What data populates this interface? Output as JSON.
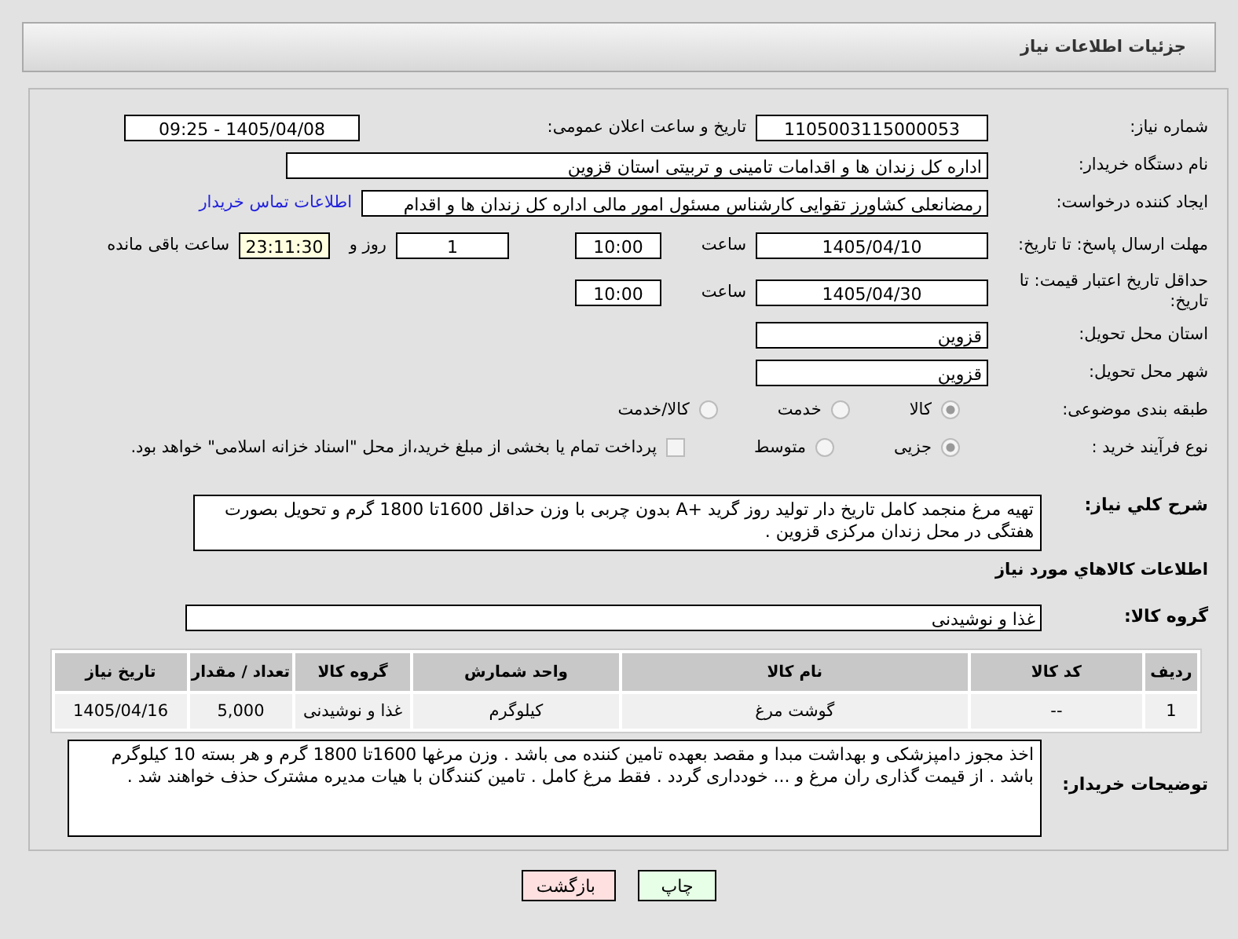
{
  "header": {
    "title": "جزئیات اطلاعات نیاز"
  },
  "need_number": {
    "label": "شماره نیاز:",
    "value": "1105003115000053"
  },
  "announce": {
    "label": "تاریخ و ساعت اعلان عمومی:",
    "value": "1405/04/08 - 09:25"
  },
  "buyer_org": {
    "label": "نام دستگاه خریدار:",
    "value": "اداره کل زندان ها و اقدامات تامینی و تربیتی استان قزوین"
  },
  "requester": {
    "label": "ایجاد کننده درخواست:",
    "value": "رمضانعلی کشاورز تقوایی کارشناس مسئول امور مالی  اداره کل زندان ها و اقدام",
    "link": "اطلاعات تماس خریدار"
  },
  "response_deadline": {
    "label": "مهلت ارسال پاسخ: تا تاریخ:",
    "date": "1405/04/10",
    "time_label": "ساعت",
    "time": "10:00",
    "days": "1",
    "days_label": "روز و",
    "remaining": "23:11:30",
    "remaining_label": "ساعت باقی مانده"
  },
  "price_validity": {
    "label": "حداقل تاریخ اعتبار قیمت: تا تاریخ:",
    "date": "1405/04/30",
    "time_label": "ساعت",
    "time": "10:00"
  },
  "province": {
    "label": "استان محل تحویل:",
    "value": "قزوین"
  },
  "city": {
    "label": "شهر محل تحویل:",
    "value": "قزوین"
  },
  "category": {
    "label": "طبقه بندی موضوعی:",
    "options": [
      {
        "label": "کالا",
        "selected": true
      },
      {
        "label": "خدمت",
        "selected": false
      },
      {
        "label": "کالا/خدمت",
        "selected": false
      }
    ]
  },
  "process": {
    "label": "نوع فرآیند خرید :",
    "options": [
      {
        "label": "جزیی",
        "selected": true
      },
      {
        "label": "متوسط",
        "selected": false
      }
    ],
    "payment": {
      "checked": false,
      "text": "پرداخت تمام یا بخشی از مبلغ خرید،از محل \"اسناد خزانه اسلامی\" خواهد بود."
    }
  },
  "description": {
    "label": "شرح کلي نياز:",
    "value": "تهیه مرغ منجمد کامل تاریخ دار تولید روز گرید +A بدون چربی با وزن حداقل 1600تا 1800 گرم و تحویل بصورت هفتگی در محل زندان مرکزی قزوین ."
  },
  "goods_section": {
    "title": "اطلاعات کالاهاي مورد نياز"
  },
  "goods_group": {
    "label": "گروه کالا:",
    "value": "غذا و نوشیدنی"
  },
  "table": {
    "columns": [
      "ردیف",
      "کد کالا",
      "نام کالا",
      "واحد شمارش",
      "گروه کالا",
      "تعداد / مقدار",
      "تاریخ نیاز"
    ],
    "rows": [
      [
        "1",
        "--",
        "گوشت مرغ",
        "کیلوگرم",
        "غذا و نوشیدنی",
        "5,000",
        "1405/04/16"
      ]
    ]
  },
  "buyer_notes": {
    "label": "توضیحات خریدار:",
    "value": "اخذ مجوز دامپزشکی و بهداشت مبدا و مقصد بعهده تامین کننده می باشد . وزن مرغها 1600تا 1800 گرم و هر بسته 10 کیلوگرم باشد . از قیمت گذاری ران مرغ و ... خودداری گردد . فقط مرغ کامل . تامین کنندگان با هیات مدیره مشترک حذف خواهند شد ."
  },
  "buttons": [
    {
      "kind": "print",
      "label": "چاپ"
    },
    {
      "kind": "back",
      "label": "بازگشت"
    }
  ]
}
